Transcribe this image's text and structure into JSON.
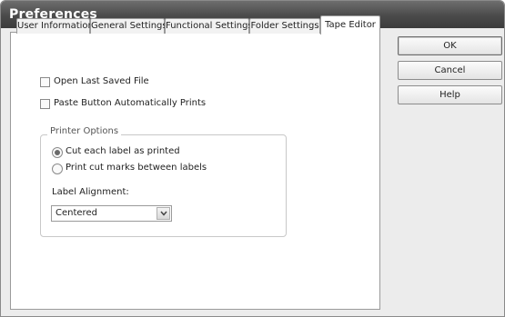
{
  "window": {
    "title": "Preferences"
  },
  "tabs": [
    {
      "label": "User Information",
      "active": false
    },
    {
      "label": "General Settings",
      "active": false
    },
    {
      "label": "Functional Settings",
      "active": false
    },
    {
      "label": "Folder Settings",
      "active": false
    },
    {
      "label": "Tape Editor",
      "active": true
    }
  ],
  "tape_editor": {
    "open_last_saved": {
      "label": "Open Last Saved File",
      "checked": false
    },
    "paste_auto_prints": {
      "label": "Paste Button Automatically Prints",
      "checked": false
    },
    "printer_options": {
      "title": "Printer Options",
      "radios": [
        {
          "label": "Cut each label as printed",
          "selected": true
        },
        {
          "label": "Print cut marks between labels",
          "selected": false
        }
      ]
    },
    "label_alignment": {
      "label": "Label Alignment:",
      "value": "Centered"
    }
  },
  "buttons": {
    "ok": "OK",
    "cancel": "Cancel",
    "help": "Help"
  }
}
